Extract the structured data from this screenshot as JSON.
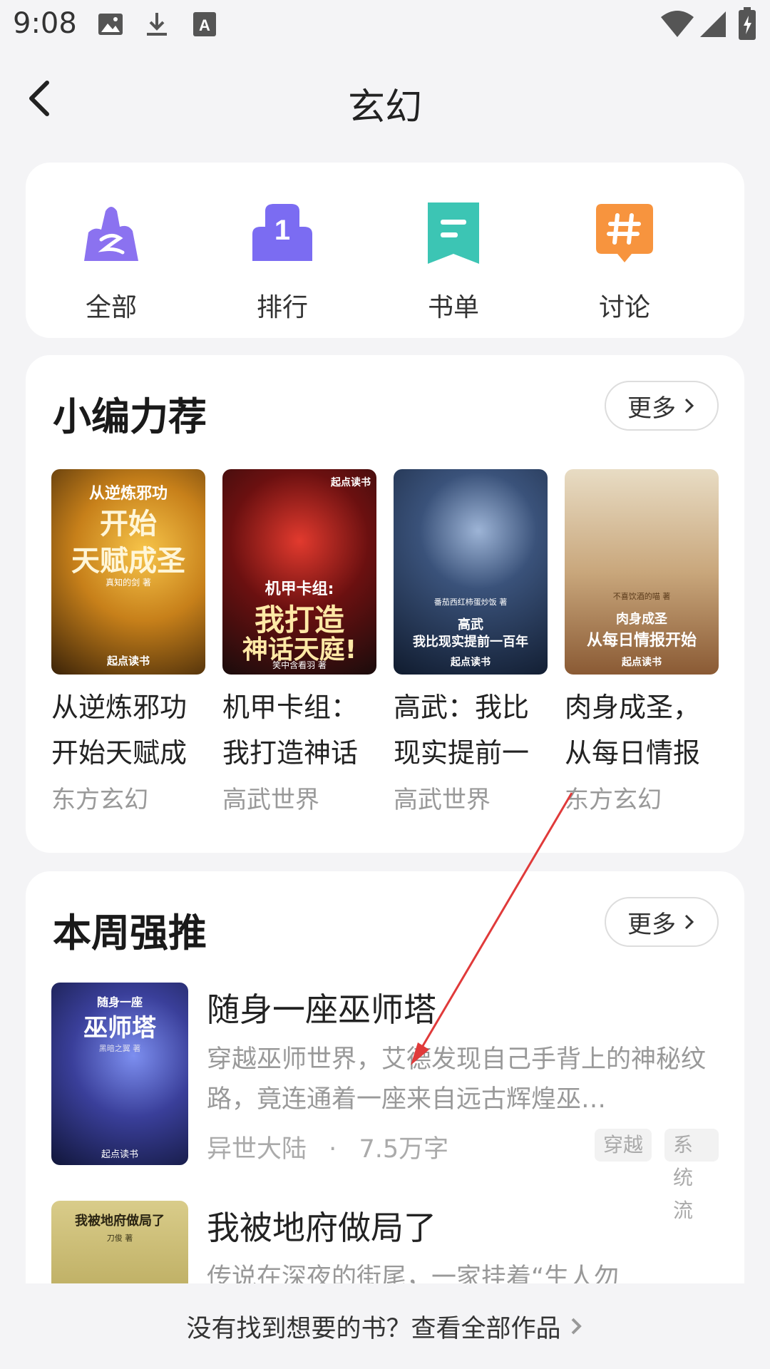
{
  "status": {
    "time": "9:08"
  },
  "header": {
    "title": "玄幻"
  },
  "categories": [
    {
      "label": "全部",
      "icon": "mountain-icon",
      "color": "#8b72f0"
    },
    {
      "label": "排行",
      "icon": "rank-1-icon",
      "color": "#7b6cf2"
    },
    {
      "label": "书单",
      "icon": "bookmark-list-icon",
      "color": "#3cc5b4"
    },
    {
      "label": "讨论",
      "icon": "hashtag-bubble-icon",
      "color": "#f7943e"
    }
  ],
  "editor_picks": {
    "title": "小编力荐",
    "more": "更多",
    "books": [
      {
        "name": "从逆炼邪功开始天赋成圣",
        "genre": "东方玄幻",
        "cover_line1": "从逆炼邪功",
        "cover_line2": "开始",
        "cover_line3": "天赋成圣",
        "cover_author": "真知的剑 著",
        "cover_publisher": "起点读书"
      },
      {
        "name": "机甲卡组：我打造神话天庭",
        "genre": "高武世界",
        "cover_line1": "机甲卡组:",
        "cover_line2": "我打造",
        "cover_line3": "神话天庭!",
        "cover_author": "笑中含看羽 著",
        "cover_publisher": "起点读书"
      },
      {
        "name": "高武：我比现实提前一百年",
        "genre": "高武世界",
        "cover_line1": "高武",
        "cover_line2": "我比现实提前一百年",
        "cover_line3": "",
        "cover_author": "番茄西红柿蛋炒饭 著",
        "cover_publisher": "起点读书"
      },
      {
        "name": "肉身成圣，从每日情报开始",
        "genre": "东方玄幻",
        "cover_line1": "肉身成圣",
        "cover_line2": "从每日情报开始",
        "cover_line3": "",
        "cover_author": "不喜饮酒的喵 著",
        "cover_publisher": "起点读书"
      }
    ]
  },
  "weekly": {
    "title": "本周强推",
    "more": "更多",
    "books": [
      {
        "name": "随身一座巫师塔",
        "desc": "穿越巫师世界，艾德发现自己手背上的神秘纹路，竟连通着一座来自远古辉煌巫…",
        "genre": "异世大陆",
        "sep": "·",
        "words": "7.5万字",
        "tags": [
          "穿越",
          "系统流"
        ],
        "cover_line1": "随身一座",
        "cover_line2": "巫师塔",
        "cover_author": "黑暗之翼 著",
        "cover_publisher": "起点读书"
      },
      {
        "name": "我被地府做局了",
        "desc": "传说在深夜的街尾，一家挂着“生人勿",
        "cover_line1": "我被地府做局了",
        "cover_author": "刀俊 著"
      }
    ]
  },
  "footer": {
    "text": "没有找到想要的书？查看全部作品"
  }
}
